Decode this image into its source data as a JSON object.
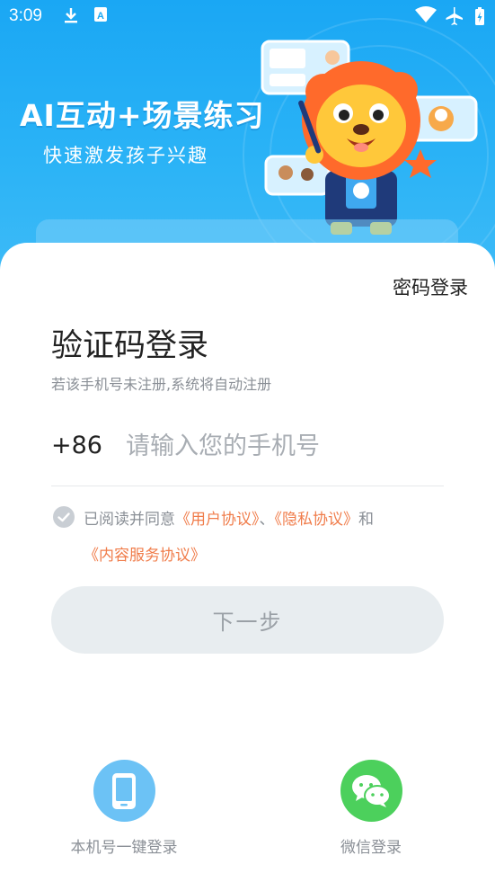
{
  "status_bar": {
    "time": "3:09"
  },
  "hero": {
    "title": "AI互动+场景练习",
    "subtitle": "快速激发孩子兴趣"
  },
  "login": {
    "password_login_link": "密码登录",
    "title": "验证码登录",
    "subtitle": "若该手机号未注册,系统将自动注册",
    "country_code": "+86",
    "phone_placeholder": "请输入您的手机号",
    "phone_value": "",
    "agreement": {
      "prefix": "已阅读并同意",
      "user_agreement": "《用户协议》",
      "separator": "、",
      "privacy_agreement": "《隐私协议》",
      "and": "和",
      "content_service_agreement": "《内容服务协议》",
      "checked": true
    },
    "next_button": "下一步"
  },
  "alt_logins": [
    {
      "label": "本机号一键登录",
      "icon": "phone-icon",
      "color": "#6cc2f5"
    },
    {
      "label": "微信登录",
      "icon": "wechat-icon",
      "color": "#4cd05c"
    }
  ],
  "colors": {
    "hero_blue": "#1aa7f4",
    "link_orange": "#f07c4a",
    "button_bg": "#e8edf0",
    "muted_text": "#8a8f96"
  }
}
